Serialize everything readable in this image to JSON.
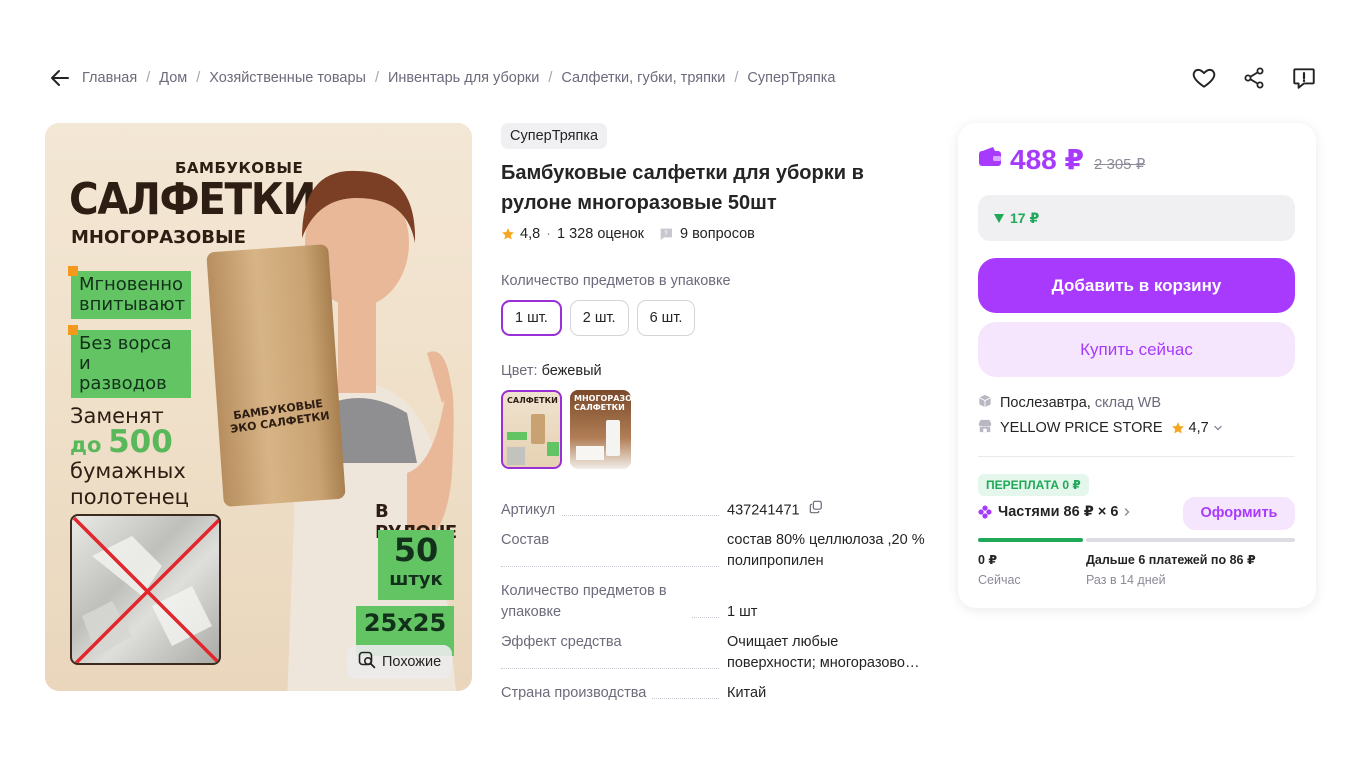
{
  "breadcrumbs": [
    "Главная",
    "Дом",
    "Хозяйственные товары",
    "Инвентарь для уборки",
    "Салфетки, губки, тряпки",
    "СуперТряпка"
  ],
  "breadcrumb_separator": "/",
  "gallery": {
    "subtitle_top": "БАМБУКОВЫЕ",
    "title": "САЛФЕТКИ",
    "subtitle_bottom": "МНОГОРАЗОВЫЕ",
    "badge_1_line_1": "Мгновенно",
    "badge_1_line_2": "впитывают",
    "badge_2_line_1": "Без ворса",
    "badge_2_line_2": "и разводов",
    "replace_line_1": "Заменят",
    "replace_prefix": "до",
    "replace_number": "500",
    "replace_line_3": "бумажных",
    "replace_line_4": "полотенец",
    "roll_label_1": "БАМБУКОВЫЕ",
    "roll_label_2": "ЭКО САЛФЕТКИ",
    "in_roll": "В РУЛОНЕ",
    "count_number": "50",
    "count_unit": "штук",
    "size": "25x25",
    "similar_button": "Похожие"
  },
  "product": {
    "brand": "СуперТряпка",
    "title": "Бамбуковые салфетки для уборки в рулоне многоразовые 50шт",
    "rating": "4,8",
    "rating_separator": "·",
    "reviews": "1 328 оценок",
    "questions": "9 вопросов",
    "qty_label": "Количество предметов в упаковке",
    "qty_options": [
      "1 шт.",
      "2 шт.",
      "6 шт."
    ],
    "qty_selected": "1 шт.",
    "color_label": "Цвет:",
    "color_value": "бежевый",
    "swatch_1_text": "САЛФЕТКИ",
    "swatch_2_text": "МНОГОРАЗОВЫЕ САЛФЕТКИ"
  },
  "specs": [
    {
      "key": "Артикул",
      "value": "437241471"
    },
    {
      "key": "Состав",
      "value": "состав 80% целлюлоза ,20 % полипропилен"
    },
    {
      "key": "Количество предметов в упаковке",
      "value": "1 шт"
    },
    {
      "key": "Эффект средства",
      "value": "Очищает любые поверхности; многоразово…"
    },
    {
      "key": "Страна производства",
      "value": "Китай"
    }
  ],
  "price_card": {
    "price": "488 ₽",
    "old_price": "2 305 ₽",
    "discount": "17 ₽",
    "add_to_cart": "Добавить в корзину",
    "buy_now": "Купить сейчас",
    "delivery_day": "Послезавтра,",
    "delivery_warehouse": "склад WB",
    "store_name": "YELLOW PRICE STORE",
    "store_rating": "4,7",
    "overpay_badge": "ПЕРЕПЛАТА 0 ₽",
    "installments": "Частями 86 ₽ × 6",
    "order_button": "Оформить",
    "pay_now_amount": "0 ₽",
    "pay_now_label": "Сейчас",
    "pay_later_amount": "Дальше 6 платежей по 86 ₽",
    "pay_later_label": "Раз в 14 дней"
  },
  "colors": {
    "accent": "#a73afd",
    "accent_light": "#f6e6fd",
    "green": "#1ea858",
    "badge_green": "#63c464",
    "text": "#242424",
    "muted": "#6b6b7b"
  },
  "icons": {
    "back": "arrow-left-icon",
    "favorite": "heart-icon",
    "share": "share-icon",
    "report": "report-icon",
    "similar": "search-similar-icon",
    "star": "star-icon",
    "question": "question-bubble-icon",
    "copy": "copy-icon",
    "wallet": "wallet-icon",
    "discount": "triangle-down-icon",
    "delivery": "box-icon",
    "store": "store-icon",
    "installments": "installment-icon"
  }
}
